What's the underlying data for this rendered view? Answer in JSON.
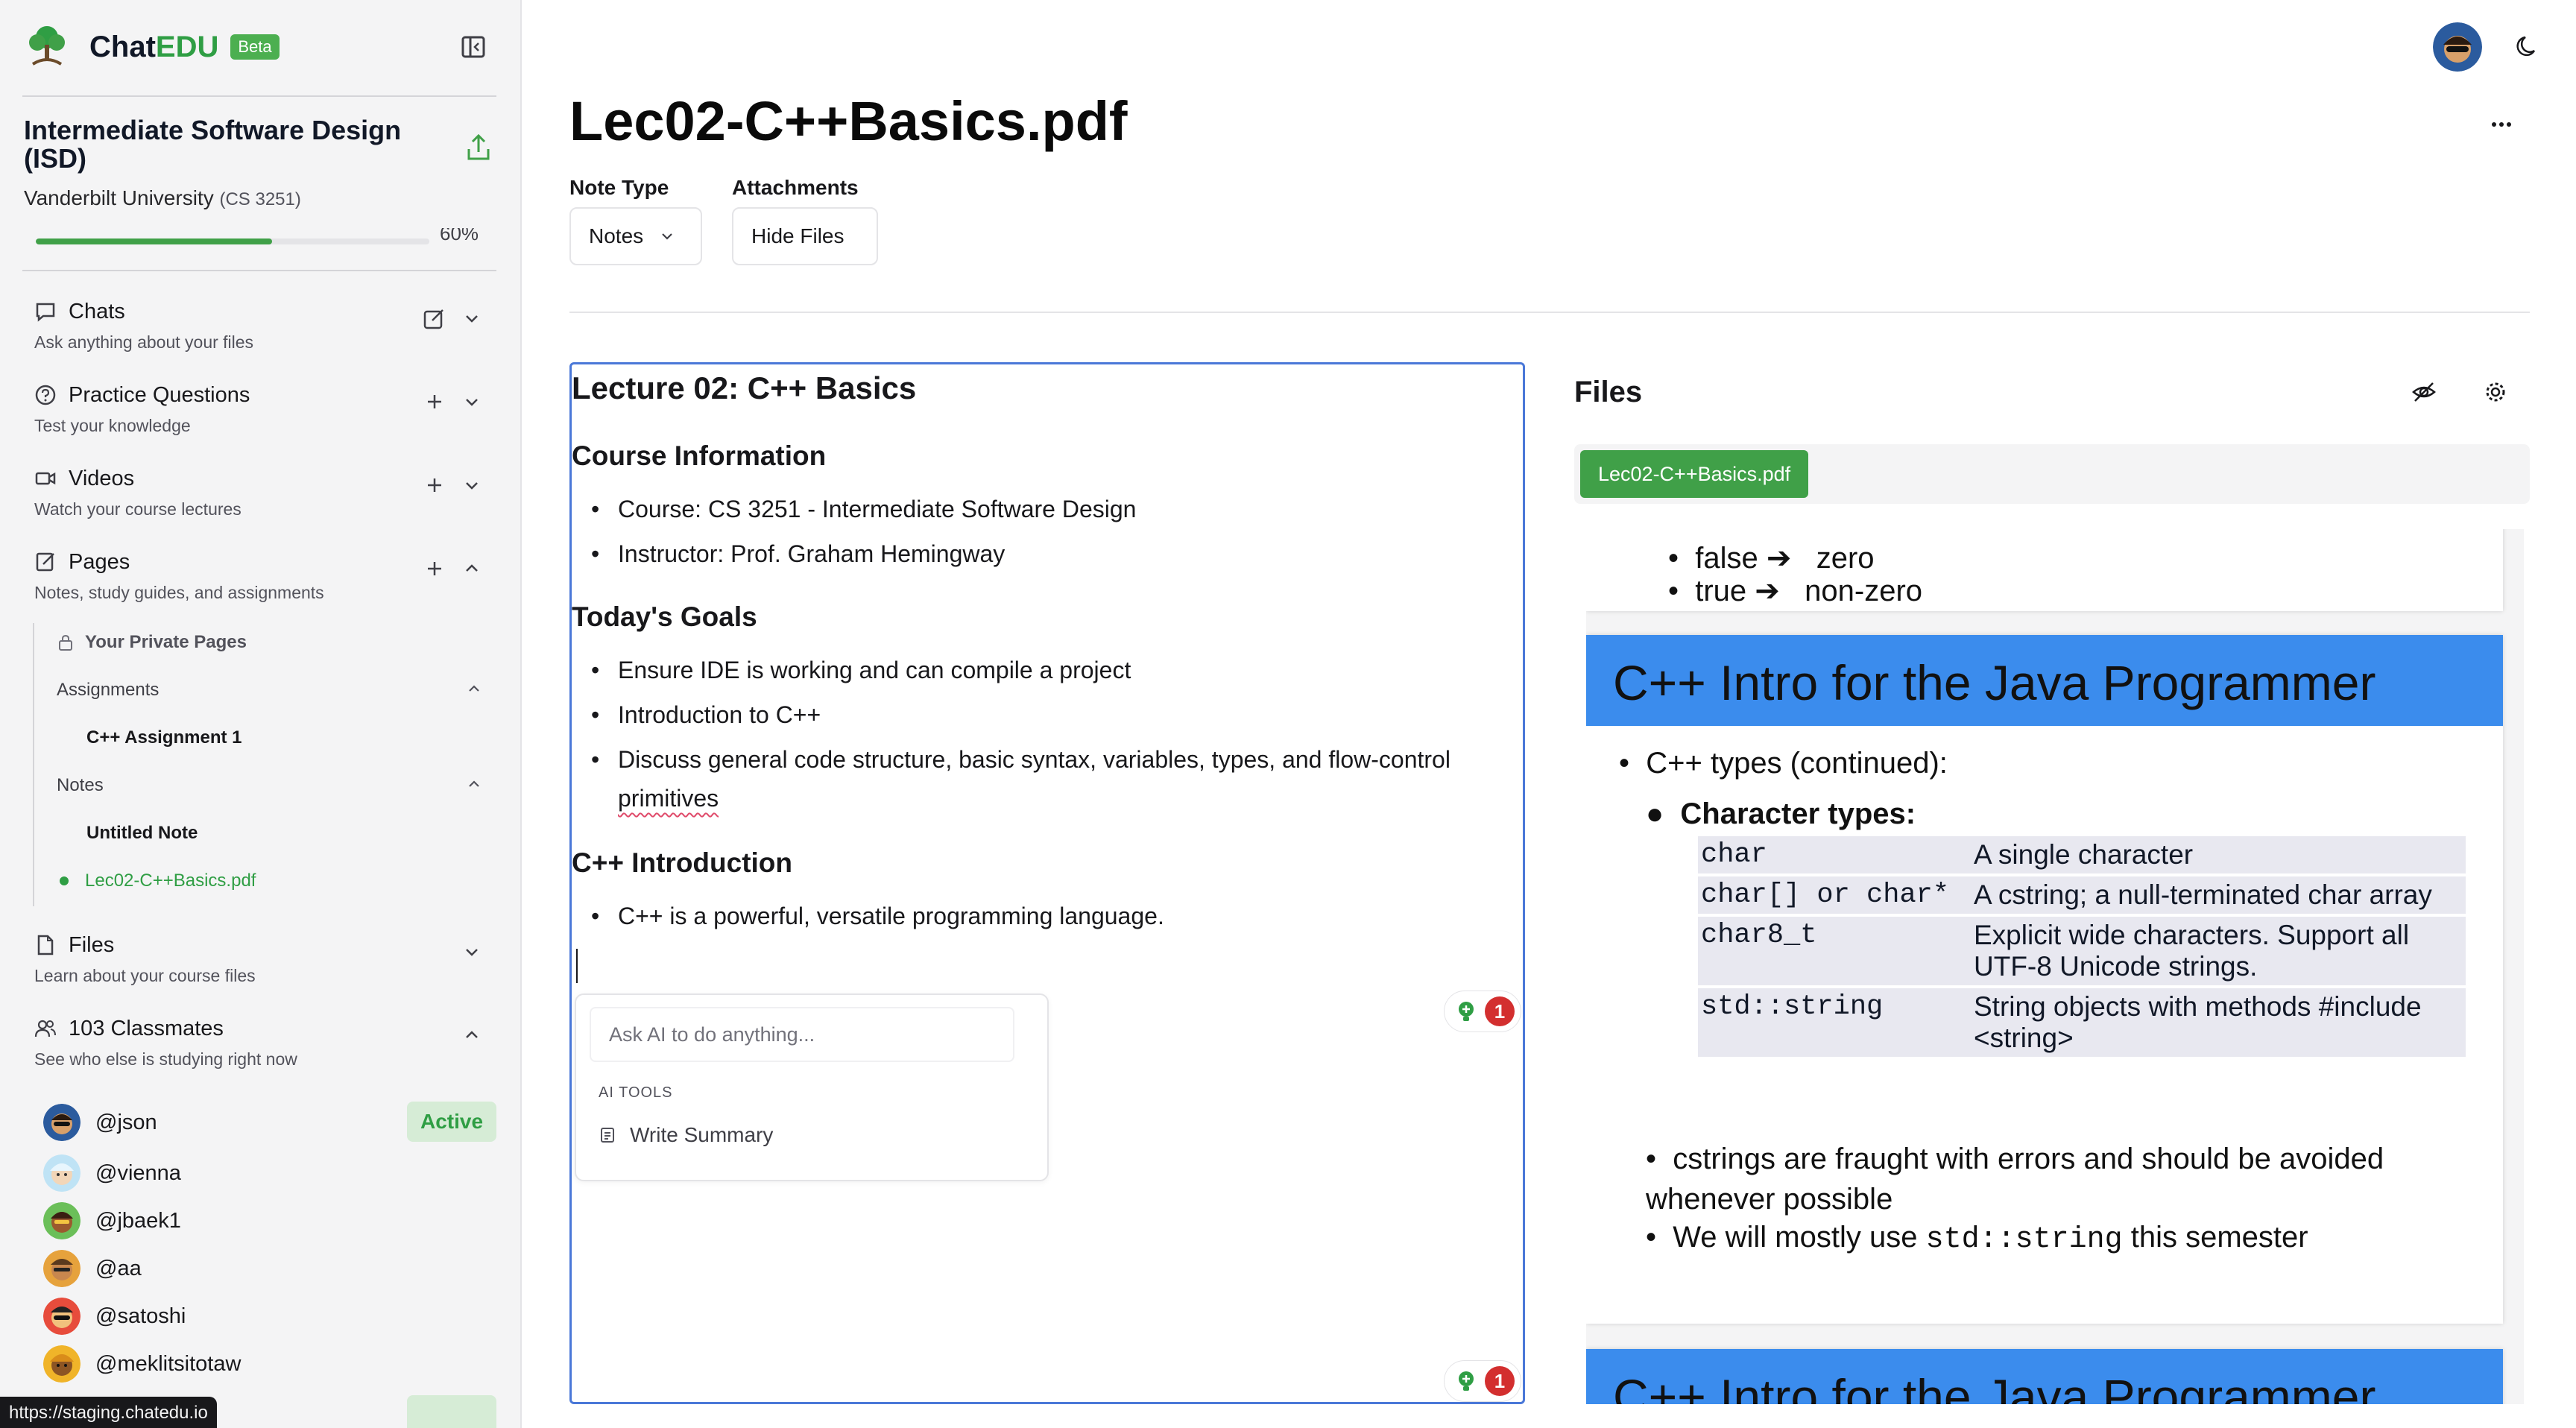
{
  "brand": {
    "name_prefix": "Chat",
    "name_suffix": "EDU",
    "badge": "Beta"
  },
  "course": {
    "title": "Intermediate Software Design (ISD)",
    "university": "Vanderbilt University",
    "code": "(CS 3251)",
    "progress_percent": 60,
    "progress_label": "60%"
  },
  "nav": {
    "chats": {
      "title": "Chats",
      "subtitle": "Ask anything about your files"
    },
    "practice": {
      "title": "Practice Questions",
      "subtitle": "Test your knowledge"
    },
    "videos": {
      "title": "Videos",
      "subtitle": "Watch your course lectures"
    },
    "pages": {
      "title": "Pages",
      "subtitle": "Notes, study guides, and assignments"
    },
    "files": {
      "title": "Files",
      "subtitle": "Learn about your course files"
    },
    "classmates": {
      "title": "103 Classmates",
      "subtitle": "See who else is studying right now"
    }
  },
  "pages_tree": {
    "private": "Your Private Pages",
    "assignments_label": "Assignments",
    "assignment_item": "C++ Assignment 1",
    "notes_label": "Notes",
    "note_items": [
      "Untitled Note",
      "Lec02-C++Basics.pdf"
    ]
  },
  "classmates": [
    {
      "handle": "@json",
      "badge": "Active"
    },
    {
      "handle": "@vienna"
    },
    {
      "handle": "@jbaek1"
    },
    {
      "handle": "@aa"
    },
    {
      "handle": "@satoshi"
    },
    {
      "handle": "@meklitsitotaw"
    }
  ],
  "status_url": "https://staging.chatedu.io",
  "document": {
    "title": "Lec02-C++Basics.pdf",
    "note_type_label": "Note Type",
    "note_type_value": "Notes",
    "attachments_label": "Attachments",
    "hide_files": "Hide Files"
  },
  "editor": {
    "h1": "Lecture 02: C++ Basics",
    "course_info_heading": "Course Information",
    "course_info_items": [
      "Course: CS 3251 - Intermediate Software Design",
      "Instructor: Prof. Graham Hemingway"
    ],
    "goals_heading": "Today's Goals",
    "goals_items": [
      "Ensure IDE is working and can compile a project",
      "Introduction to C++"
    ],
    "goal_last_text": "Discuss general code structure, basic syntax, variables, types, and flow-control ",
    "goal_last_misspelled": "primitives",
    "intro_heading": "C++ Introduction",
    "intro_items": [
      "C++ is a powerful, versatile programming language."
    ],
    "ai_placeholder": "Ask AI to do anything...",
    "ai_tools_label": "AI TOOLS",
    "ai_write_summary": "Write Summary",
    "comment_count_1": "1",
    "comment_count_2": "1"
  },
  "files_panel": {
    "title": "Files",
    "active_file": "Lec02-C++Basics.pdf",
    "slide_prev": {
      "line1_a": "false ➔",
      "line1_b": "zero",
      "line2_a": "true ➔",
      "line2_b": "non-zero"
    },
    "slide": {
      "title": "C++ Intro for the Java Programmer",
      "bullet1": "C++ types (continued):",
      "bullet2": "Character types:",
      "table": [
        [
          "char",
          "A single character"
        ],
        [
          "char[] or char*",
          "A cstring; a null-terminated char array"
        ],
        [
          "char8_t",
          "Explicit wide characters.  Support all UTF-8 Unicode strings."
        ],
        [
          "std::string",
          "String objects with methods #include <string>"
        ]
      ],
      "bullet3": "cstrings are fraught with errors and should be avoided whenever possible",
      "bullet4_pre": "We will mostly use ",
      "bullet4_code": "std::string",
      "bullet4_post": " this semester"
    },
    "next_slide_title": "C++ Intro for the Java Programmer"
  },
  "colors": {
    "accent_green": "#40a048",
    "slide_blue": "#3b8ced",
    "editor_border": "#4a78d8",
    "badge_red": "#d32f2f"
  }
}
